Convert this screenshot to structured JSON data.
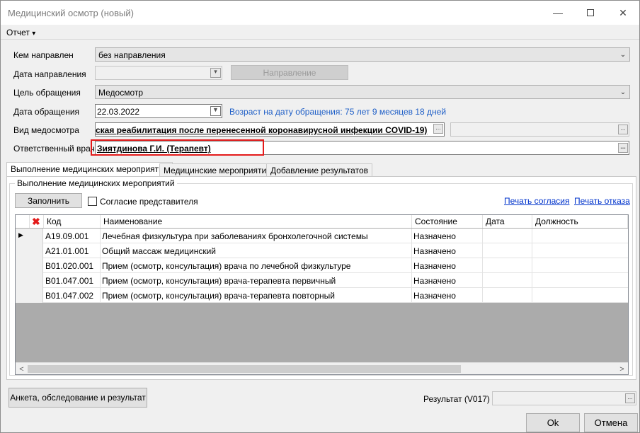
{
  "window": {
    "title": "Медицинский осмотр (новый)",
    "controls": [
      "minimize-icon",
      "maximize-icon",
      "close-icon"
    ]
  },
  "menu": {
    "report": "Отчет",
    "report_arrow": "▾"
  },
  "form": {
    "referred_by_label": "Кем направлен",
    "referred_by_value": "без направления",
    "referral_date_label": "Дата направления",
    "referral_button": "Направление",
    "purpose_label": "Цель обращения",
    "purpose_value": "Медосмотр",
    "visit_date_label": "Дата обращения",
    "visit_date_value": "22.03.2022",
    "age_info": "Возраст на дату обращения:  75 лет 9 месяцев 18 дней",
    "exam_type_label": "Вид медосмотра",
    "exam_type_value": "ская реабилитация после перенесенной коронавирусной инфекции COVID-19)",
    "doctor_label": "Ответственный врач",
    "doctor_value": "Зиятдинова Г.И. (Терапевт)",
    "dots": "..."
  },
  "tabs": [
    {
      "label": "Выполнение медицинских мероприятий",
      "active": true
    },
    {
      "label": "Медицинские мероприятия",
      "active": false
    },
    {
      "label": "Добавление результатов",
      "active": false
    }
  ],
  "panel": {
    "group_title": "Выполнение медицинских мероприятий",
    "fill_button": "Заполнить",
    "consent_checkbox": "Согласие представителя",
    "print_consent": "Печать согласия",
    "print_refusal": "Печать отказа"
  },
  "grid": {
    "columns": [
      "Код",
      "Наименование",
      "Состояние",
      "Дата",
      "Должность"
    ],
    "rows": [
      {
        "code": "A19.09.001",
        "name": "Лечебная физкультура при заболеваниях бронхолегочной системы",
        "status": "Назначено",
        "date": "",
        "position": ""
      },
      {
        "code": "A21.01.001",
        "name": "Общий массаж медицинский",
        "status": "Назначено",
        "date": "",
        "position": ""
      },
      {
        "code": "B01.020.001",
        "name": "Прием (осмотр, консультация) врача по лечебной физкультуре",
        "status": "Назначено",
        "date": "",
        "position": ""
      },
      {
        "code": "B01.047.001",
        "name": "Прием (осмотр, консультация) врача-терапевта первичный",
        "status": "Назначено",
        "date": "",
        "position": ""
      },
      {
        "code": "B01.047.002",
        "name": "Прием (осмотр, консультация) врача-терапевта повторный",
        "status": "Назначено",
        "date": "",
        "position": ""
      }
    ],
    "selected_row_marker": "▶",
    "scroll_left": "<",
    "scroll_right": ">"
  },
  "footer": {
    "questionnaire_button": "Анкета, обследование и результат",
    "result_label": "Результат (V017)",
    "ok_button": "Ok",
    "cancel_button": "Отмена"
  },
  "colors": {
    "link": "#0033cc",
    "age_info": "#1f5fc7",
    "highlight_rect": "#e31a1a",
    "grid_empty_area": "#ababab"
  }
}
